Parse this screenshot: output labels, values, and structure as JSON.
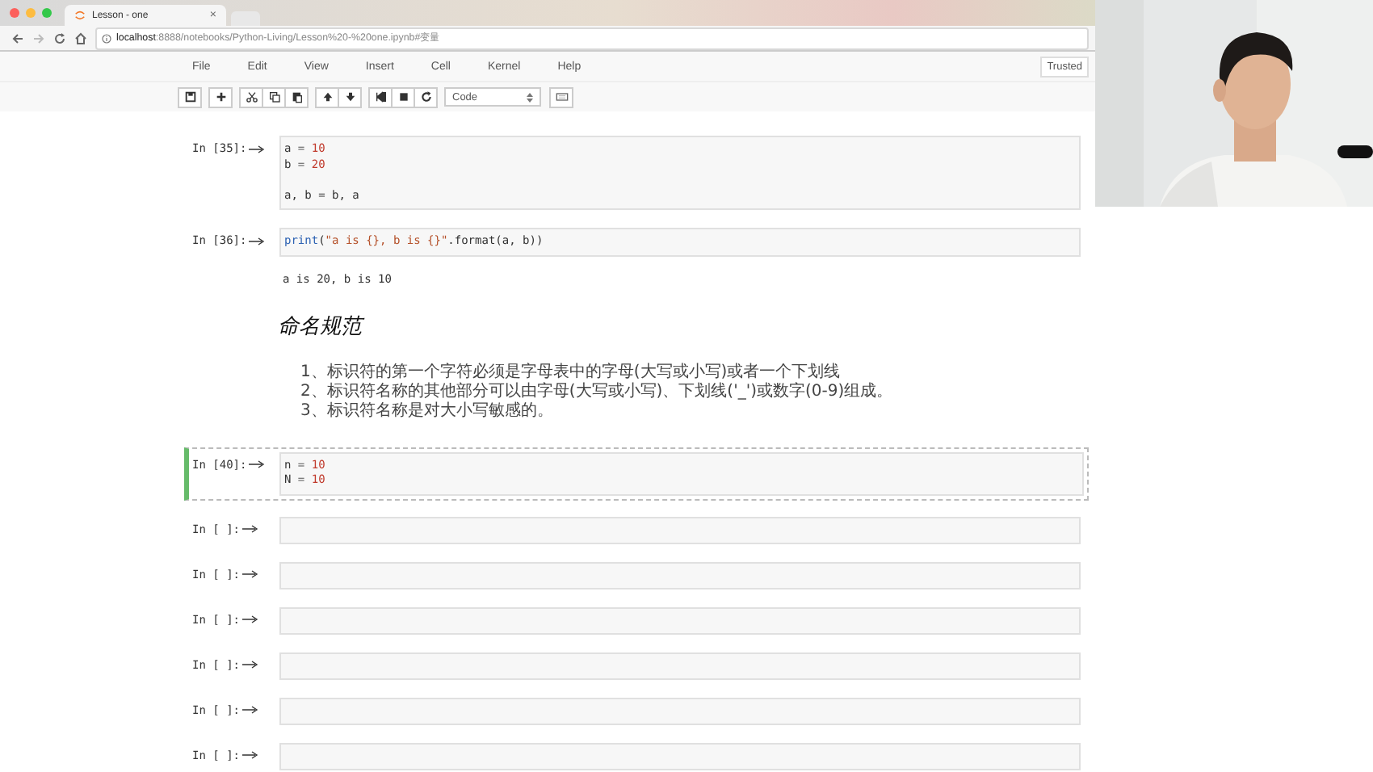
{
  "browser": {
    "tab": {
      "title": "Lesson - one",
      "close": "×"
    },
    "address": {
      "host": "localhost",
      "path": ":8888/notebooks/Python-Living/Lesson%20-%20one.ipynb#变量"
    }
  },
  "menu": [
    "File",
    "Edit",
    "View",
    "Insert",
    "Cell",
    "Kernel",
    "Help"
  ],
  "trusted": "Trusted",
  "toolbar": {
    "cell_type": "Code"
  },
  "cells": [
    {
      "kind": "code",
      "prompt": "In [35]:",
      "selected": false,
      "lines": [
        {
          "blank_before": false,
          "tokens": [
            {
              "text": "a",
              "kind": "name"
            },
            {
              "text": " = ",
              "kind": "op"
            },
            {
              "text": "10",
              "kind": "num"
            }
          ]
        },
        {
          "blank_before": false,
          "tokens": [
            {
              "text": "b",
              "kind": "name"
            },
            {
              "text": " = ",
              "kind": "op"
            },
            {
              "text": "20",
              "kind": "num"
            }
          ]
        },
        {
          "blank_before": true,
          "tokens": [
            {
              "text": "a, b = b, a",
              "kind": "name"
            }
          ]
        }
      ]
    },
    {
      "kind": "code",
      "prompt": "In [36]:",
      "selected": false,
      "lines": [
        {
          "blank_before": false,
          "tokens": [
            {
              "text": "print",
              "kind": "builtin"
            },
            {
              "text": "(",
              "kind": "name"
            },
            {
              "text": "\"a is {}, b is {}\"",
              "kind": "str"
            },
            {
              "text": ".format(a, b))",
              "kind": "name"
            }
          ]
        }
      ],
      "output": "a is 20, b is 10"
    },
    {
      "kind": "heading",
      "text": "命名规范"
    },
    {
      "kind": "list",
      "items": [
        "1、标识符的第一个字符必须是字母表中的字母(大写或小写)或者一个下划线",
        "2、标识符名称的其他部分可以由字母(大写或小写)、下划线('_')或数字(0-9)组成。",
        "3、标识符名称是对大小写敏感的。"
      ]
    },
    {
      "kind": "code",
      "prompt": "In [40]:",
      "selected": true,
      "lines": [
        {
          "blank_before": false,
          "tokens": [
            {
              "text": "n",
              "kind": "name"
            },
            {
              "text": " = ",
              "kind": "op"
            },
            {
              "text": "10",
              "kind": "num"
            }
          ]
        },
        {
          "blank_before": false,
          "tokens": [
            {
              "text": "N",
              "kind": "name"
            },
            {
              "text": " = ",
              "kind": "op"
            },
            {
              "text": "10",
              "kind": "num"
            }
          ]
        }
      ]
    },
    {
      "kind": "code",
      "prompt": "In [ ]:",
      "selected": false
    },
    {
      "kind": "code",
      "prompt": "In [ ]:",
      "selected": false
    },
    {
      "kind": "code",
      "prompt": "In [ ]:",
      "selected": false
    },
    {
      "kind": "code",
      "prompt": "In [ ]:",
      "selected": false
    },
    {
      "kind": "code",
      "prompt": "In [ ]:",
      "selected": false
    },
    {
      "kind": "code",
      "prompt": "In [ ]:",
      "selected": false
    }
  ]
}
